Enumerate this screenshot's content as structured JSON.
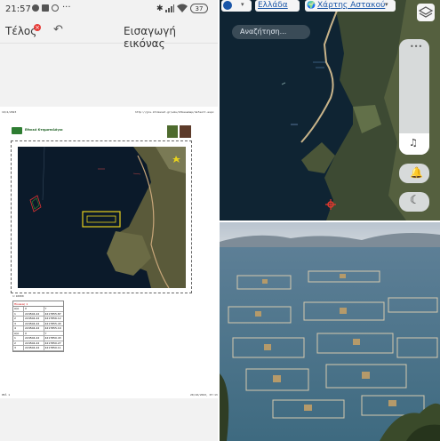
{
  "status_bar": {
    "time": "21:57",
    "more": "···",
    "battery": "37"
  },
  "toolbar": {
    "done_label": "Τέλος",
    "title": "Εισαγωγή εικόνας"
  },
  "document": {
    "header_left": "19/4/2023",
    "header_right": "http://gis.ktimanet.gr/wms/ktbasemap/default.aspx",
    "org_name": "Εθνικό Κτηματολόγιο",
    "scale_text": "1:10000",
    "footer_left": "σελ 1",
    "footer_right": "20/10/2023, 07:13",
    "table_title": "Πίνακας 1",
    "table_rows": [
      [
        "A/A",
        "X",
        "Y"
      ],
      [
        "1",
        "224504.42",
        "4217855.87"
      ],
      [
        "2",
        "224504.42",
        "4217856.12"
      ],
      [
        "3",
        "224504.42",
        "4217855.43"
      ],
      [
        "4",
        "224504.42",
        "4217855.19"
      ],
      [
        "A/A",
        "X",
        "Y"
      ],
      [
        "1",
        "224504.42",
        "4217850.43"
      ],
      [
        "2",
        "224504.42",
        "4217850.27"
      ],
      [
        "3",
        "224504.42",
        "4217850.11"
      ]
    ]
  },
  "map": {
    "region_label": "Ελλάδα",
    "layer_label": "Χάρτης Αστακού",
    "search_placeholder": "Αναζήτηση...",
    "icons": [
      "globe-icon",
      "layers-icon",
      "music-icon",
      "bell-icon",
      "moon-icon"
    ]
  },
  "colors": {
    "accent_blue": "#1a73e8",
    "map_water": "#0f2433",
    "yellow_marker": "#e8d21c",
    "toolbar_bg": "#f2f2f2"
  }
}
